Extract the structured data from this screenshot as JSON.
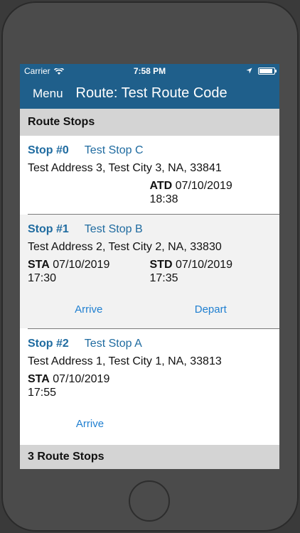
{
  "status_bar": {
    "carrier": "Carrier",
    "time": "7:58 PM",
    "battery_level": 0.9
  },
  "nav": {
    "menu_label": "Menu",
    "title": "Route: Test Route Code"
  },
  "section_header": "Route Stops",
  "stops": [
    {
      "num": "Stop #0",
      "name": "Test Stop C",
      "address": "Test Address 3,  Test City 3,  NA,  33841",
      "atd_label": "ATD",
      "atd_date": "07/10/2019",
      "atd_time": "18:38"
    },
    {
      "num": "Stop #1",
      "name": "Test Stop B",
      "address": "Test Address 2,  Test City 2,  NA,  33830",
      "sta_label": "STA",
      "sta_date": "07/10/2019",
      "sta_time": "17:30",
      "std_label": "STD",
      "std_date": "07/10/2019",
      "std_time": "17:35",
      "arrive_label": "Arrive",
      "depart_label": "Depart"
    },
    {
      "num": "Stop #2",
      "name": "Test Stop A",
      "address": "Test Address 1,  Test City 1,  NA,  33813",
      "sta_label": "STA",
      "sta_date": "07/10/2019",
      "sta_time": "17:55",
      "arrive_label": "Arrive"
    }
  ],
  "footer": "3 Route Stops"
}
